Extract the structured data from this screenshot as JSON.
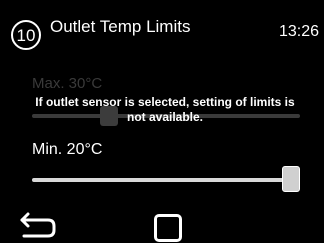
{
  "header": {
    "step_number": "10",
    "title": "Outlet Temp Limits",
    "time": "13:26"
  },
  "max_limit": {
    "label": "Max. 30°C",
    "enabled": false,
    "slider_level": 0.27
  },
  "notice": {
    "text": "If outlet sensor is selected, setting of limits is not available."
  },
  "min_limit": {
    "label": "Min. 20°C",
    "enabled": true,
    "slider_level": 1.0
  },
  "footer": {
    "back_icon": "back-arrow-icon",
    "home_icon": "home-square-icon"
  },
  "colors": {
    "background": "#000000",
    "text": "#ffffff",
    "disabled": "#3a3a3a",
    "slider_active": "#d8d8d8"
  }
}
